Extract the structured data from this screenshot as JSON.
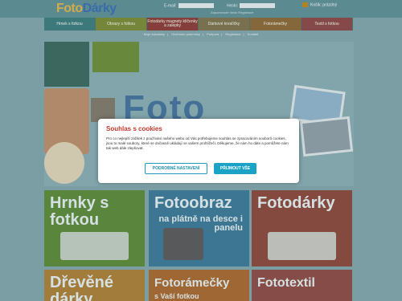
{
  "header": {
    "logo_part1": "Foto",
    "logo_part2": "Dárky",
    "email_label": "E-mail:",
    "password_label": "Heslo:",
    "register_links": "Zapomenuté heslo   Registrace",
    "cart_label": "Košík: prázdný"
  },
  "nav": {
    "items": [
      "Hrnek s fotkou",
      "Obrazy s fotkou",
      "Fotodárky magnety klíčenky a zalepky",
      "Dárkové kreslíčky",
      "Fotorámečky",
      "Textil s fotkou"
    ]
  },
  "subnav": {
    "items": [
      "Moje fotodárky",
      "Obchodní podmínky",
      "Podpora",
      "Registrace",
      "Kontakt"
    ]
  },
  "hero": {
    "text": "Foto"
  },
  "tiles": [
    {
      "title": "Hrnky s fotkou",
      "sub": ""
    },
    {
      "title": "Fotoobraz",
      "sub": "na plátně na desce i panelu"
    },
    {
      "title": "Fotodárky",
      "sub": ""
    },
    {
      "title": "Dřevěné dárky",
      "sub": ""
    },
    {
      "title": "Fotorámečky",
      "sub": "s Vaší fotkou"
    },
    {
      "title": "Fototextil",
      "sub": ""
    }
  ],
  "cookie": {
    "title": "Souhlas s cookies",
    "text": "Pro co nejlepší zážitek z používání našeho webu od Vás potřebujeme souhlas se zpracováním souborů cookies, jsou to malé soubory, které se dočasně ukládají ve vašem prohlížeči. Děkujeme, že nám ho dáte a pomůžete nám tak web dále zlepšovat.",
    "btn_settings": "PODROBNÉ NASTAVENÍ",
    "btn_accept": "PŘIJMOUT VŠE"
  }
}
